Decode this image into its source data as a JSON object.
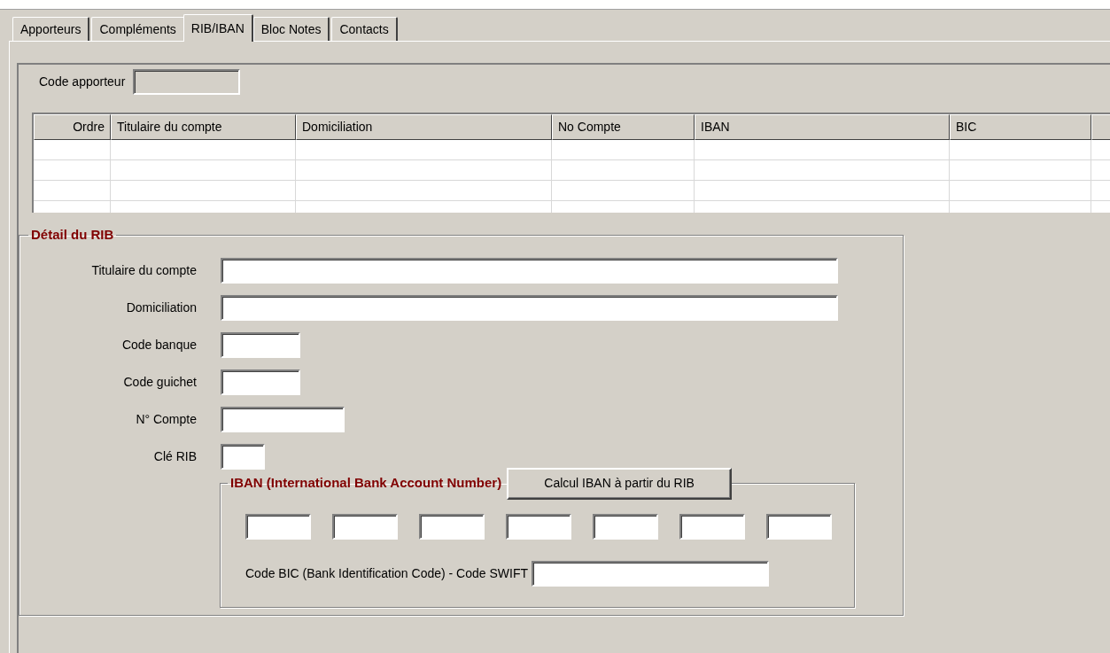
{
  "tabs": [
    {
      "label": "Apporteurs",
      "selected": false
    },
    {
      "label": "Compléments",
      "selected": false
    },
    {
      "label": "RIB/IBAN",
      "selected": true
    },
    {
      "label": "Bloc Notes",
      "selected": false
    },
    {
      "label": "Contacts",
      "selected": false
    }
  ],
  "code_apporteur": {
    "label": "Code apporteur",
    "disabled": true
  },
  "table": {
    "columns": [
      "Ordre",
      "Titulaire du compte",
      "Domiciliation",
      "No Compte",
      "IBAN",
      "BIC"
    ]
  },
  "rib_detail": {
    "title": "Détail du RIB",
    "fields": [
      {
        "label": "Titulaire du compte"
      },
      {
        "label": "Domiciliation"
      },
      {
        "label": "Code banque"
      },
      {
        "label": "Code guichet"
      },
      {
        "label": "N° Compte"
      },
      {
        "label": "Clé RIB"
      }
    ]
  },
  "iban": {
    "title": "IBAN (International Bank Account Number)",
    "button": "Calcul IBAN à partir du RIB",
    "bic_label": "Code BIC (Bank Identification Code) - Code SWIFT"
  }
}
